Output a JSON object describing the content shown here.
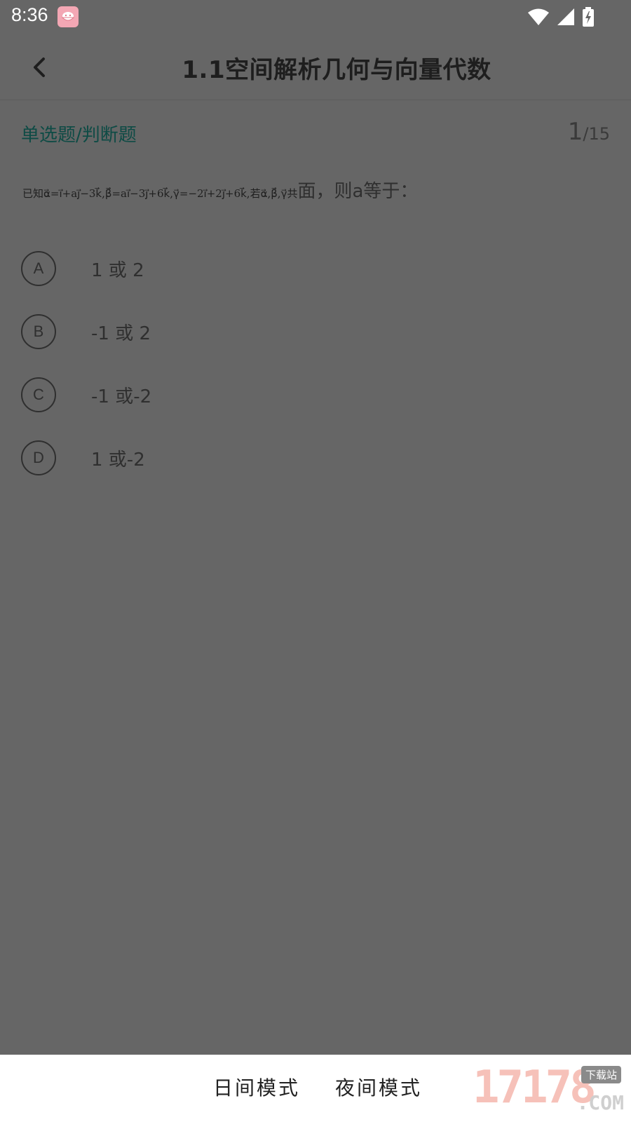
{
  "status_bar": {
    "time": "8:36",
    "app_icon": "rice-bowl-icon",
    "icons": [
      "wifi-icon",
      "cellular-signal-icon",
      "battery-charging-icon"
    ]
  },
  "toolbar": {
    "back_icon": "chevron-left-icon",
    "title": "1.1空间解析几何与向量代数"
  },
  "question": {
    "type_label": "单选题/判断题",
    "current": "1",
    "total": "/15",
    "formula_prefix": "已知",
    "formula_alpha": "α⃗=i⃗+aj⃗−3k⃗,",
    "formula_beta": "β⃗=ai⃗−3j⃗+6k⃗,",
    "formula_gamma": "γ⃗=−2i⃗+2j⃗+6k⃗,",
    "formula_cond": "若α⃗,β⃗,γ⃗共",
    "text_suffix": "面，则a等于："
  },
  "options": [
    {
      "letter": "A",
      "text": "1 或 2"
    },
    {
      "letter": "B",
      "text": "-1 或 2"
    },
    {
      "letter": "C",
      "text": "-1 或-2"
    },
    {
      "letter": "D",
      "text": "1 或-2"
    }
  ],
  "bottom_bar": {
    "day_mode": "日间模式",
    "night_mode": "夜间模式"
  },
  "watermark": {
    "digits": "17178",
    "tag": "下载站",
    "com": ".COM"
  }
}
